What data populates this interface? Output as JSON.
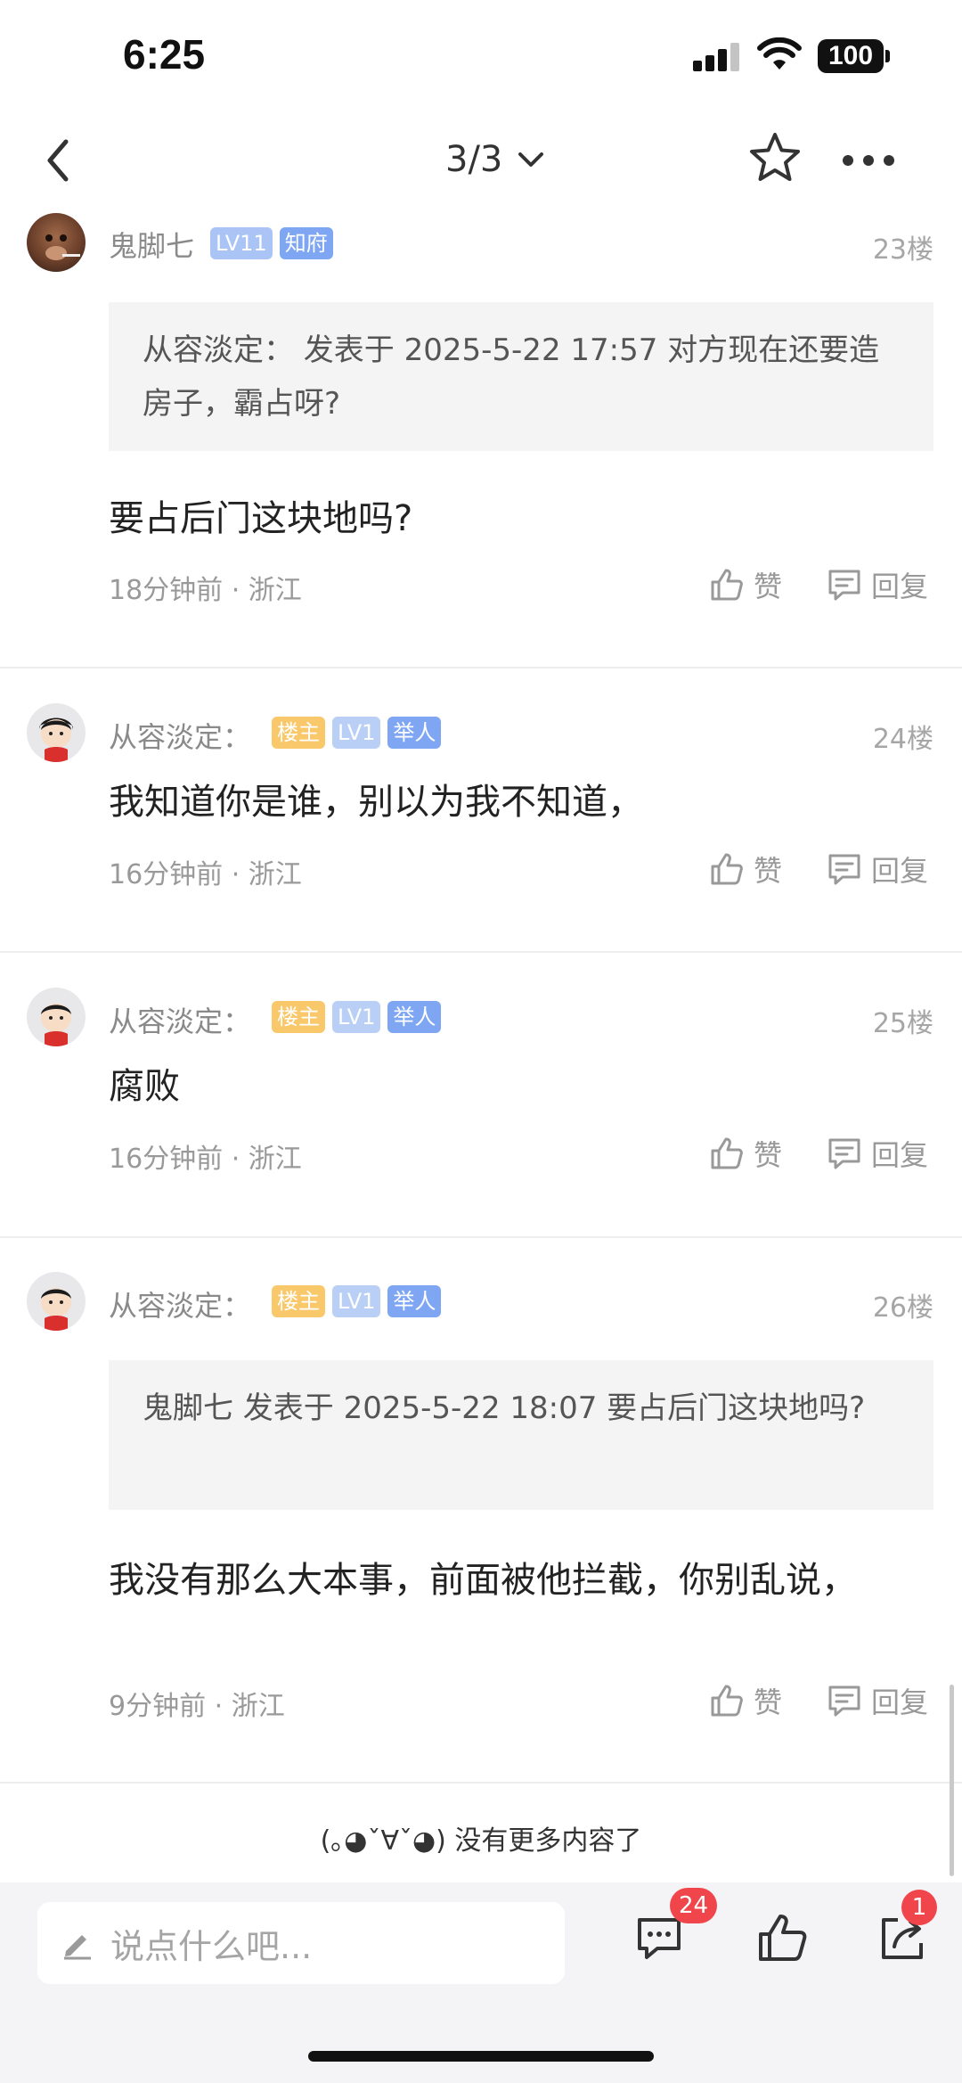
{
  "status_bar": {
    "time": "6:25",
    "battery": "100"
  },
  "nav": {
    "page_indicator": "3/3"
  },
  "posts": [
    {
      "username": "鬼脚七",
      "badges": [
        "LV11",
        "知府"
      ],
      "floor": "23楼",
      "quote": "从容淡定： 发表于 2025-5-22 17:57 对方现在还要造房子，霸占呀?",
      "content": "要占后门这块地吗?",
      "meta": "18分钟前 · 浙江",
      "like_label": "赞",
      "reply_label": "回复"
    },
    {
      "username": "从容淡定：",
      "badges": [
        "楼主",
        "LV1",
        "举人"
      ],
      "floor": "24楼",
      "content": "我知道你是谁，别以为我不知道，",
      "meta": "16分钟前 · 浙江",
      "like_label": "赞",
      "reply_label": "回复"
    },
    {
      "username": "从容淡定：",
      "badges": [
        "楼主",
        "LV1",
        "举人"
      ],
      "floor": "25楼",
      "content": "腐败",
      "meta": "16分钟前 · 浙江",
      "like_label": "赞",
      "reply_label": "回复"
    },
    {
      "username": "从容淡定：",
      "badges": [
        "楼主",
        "LV1",
        "举人"
      ],
      "floor": "26楼",
      "quote": "鬼脚七 发表于 2025-5-22 18:07 要占后门这块地吗?",
      "content": "我没有那么大本事，前面被他拦截，你别乱说，",
      "meta": "9分钟前 · 浙江",
      "like_label": "赞",
      "reply_label": "回复"
    }
  ],
  "footer_note": "(｡◕ˇ∀ˇ◕) 没有更多内容了",
  "bottom_bar": {
    "input_placeholder": "说点什么吧...",
    "comments_count": "24",
    "share_count": "1"
  },
  "icons": [
    "back-icon",
    "chevron-down-icon",
    "star-icon",
    "more-icon",
    "thumbs-up-icon",
    "reply-icon",
    "pencil-icon",
    "comment-icon",
    "share-icon"
  ]
}
